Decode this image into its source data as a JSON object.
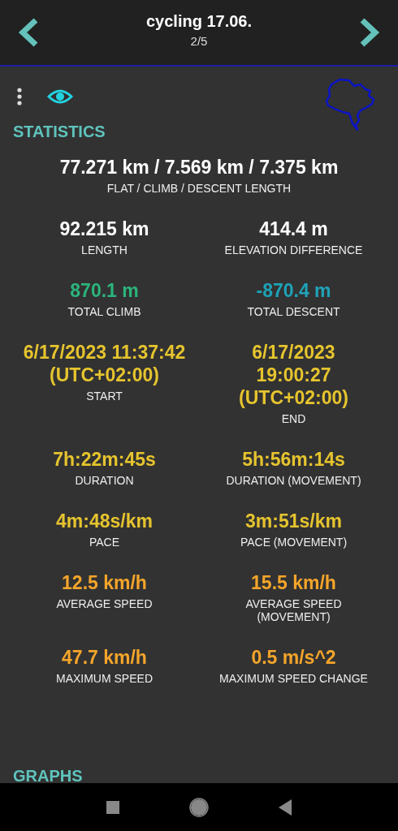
{
  "header": {
    "title": "cycling 17.06.",
    "subtitle": "2/5"
  },
  "section_title": "STATISTICS",
  "summary": {
    "value": "77.271 km / 7.569 km / 7.375 km",
    "label": "FLAT / CLIMB / DESCENT LENGTH",
    "color": "#ffffff"
  },
  "stats": [
    {
      "value": "92.215 km",
      "label": "LENGTH",
      "color": "#ffffff"
    },
    {
      "value": "414.4 m",
      "label": "ELEVATION DIFFERENCE",
      "color": "#ffffff"
    },
    {
      "value": "870.1 m",
      "label": "TOTAL CLIMB",
      "color": "#2bb47c"
    },
    {
      "value": "-870.4 m",
      "label": "TOTAL DESCENT",
      "color": "#1ea3b8"
    },
    {
      "value": "6/17/2023 11:37:42 (UTC+02:00)",
      "label": "START",
      "color": "#e6c42e"
    },
    {
      "value": "6/17/2023 19:00:27 (UTC+02:00)",
      "label": "END",
      "color": "#e6c42e"
    },
    {
      "value": "7h:22m:45s",
      "label": "DURATION",
      "color": "#e6c42e"
    },
    {
      "value": "5h:56m:14s",
      "label": "DURATION (MOVEMENT)",
      "color": "#e6c42e"
    },
    {
      "value": "4m:48s/km",
      "label": "PACE",
      "color": "#e6c42e"
    },
    {
      "value": "3m:51s/km",
      "label": "PACE (MOVEMENT)",
      "color": "#e6c42e"
    },
    {
      "value": "12.5 km/h",
      "label": "AVERAGE SPEED",
      "color": "#f5a52a"
    },
    {
      "value": "15.5 km/h",
      "label": "AVERAGE SPEED (MOVEMENT)",
      "color": "#f5a52a"
    },
    {
      "value": "47.7 km/h",
      "label": "MAXIMUM SPEED",
      "color": "#f5a52a"
    },
    {
      "value": "0.5 m/s^2",
      "label": "MAXIMUM SPEED CHANGE",
      "color": "#f5a52a"
    }
  ],
  "next_section_title": "GRAPHS"
}
